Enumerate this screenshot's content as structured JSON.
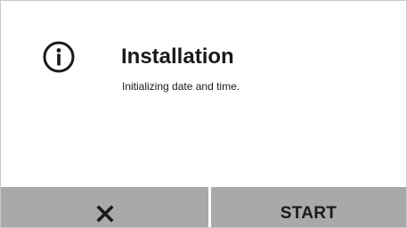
{
  "dialog": {
    "icon": "info-icon",
    "title": "Installation",
    "message": "Initializing date and time."
  },
  "buttons": {
    "cancel_icon": "close-icon",
    "start_label": "START"
  },
  "colors": {
    "background": "#ffffff",
    "button_background": "#a9a9a9",
    "text": "#1a1a1a"
  }
}
